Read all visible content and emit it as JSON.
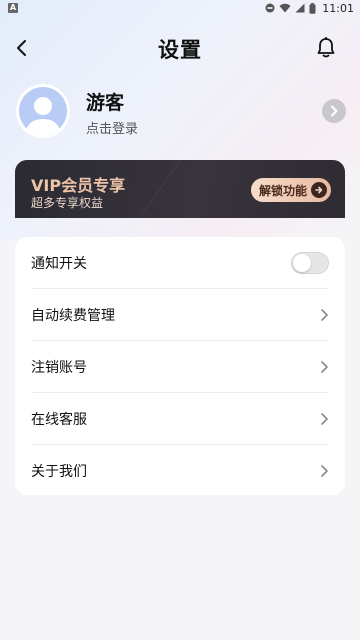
{
  "status_bar": {
    "time": "11:01",
    "notification_badge": "A"
  },
  "header": {
    "title": "设置"
  },
  "profile": {
    "username": "游客",
    "login_text": "点击登录"
  },
  "vip": {
    "title": "VIP会员专享",
    "subtitle": "超多专享权益",
    "button_label": "解锁功能"
  },
  "settings": {
    "items": [
      {
        "label": "通知开关",
        "type": "toggle",
        "enabled": false
      },
      {
        "label": "自动续费管理",
        "type": "link"
      },
      {
        "label": "注销账号",
        "type": "link"
      },
      {
        "label": "在线客服",
        "type": "link"
      },
      {
        "label": "关于我们",
        "type": "link"
      }
    ]
  },
  "colors": {
    "vip_text": "#ecc3a8",
    "vip_card_bg": "#2a2a33",
    "avatar_bg": "#b9ccf6",
    "toggle_off": "#e6e6e9"
  }
}
